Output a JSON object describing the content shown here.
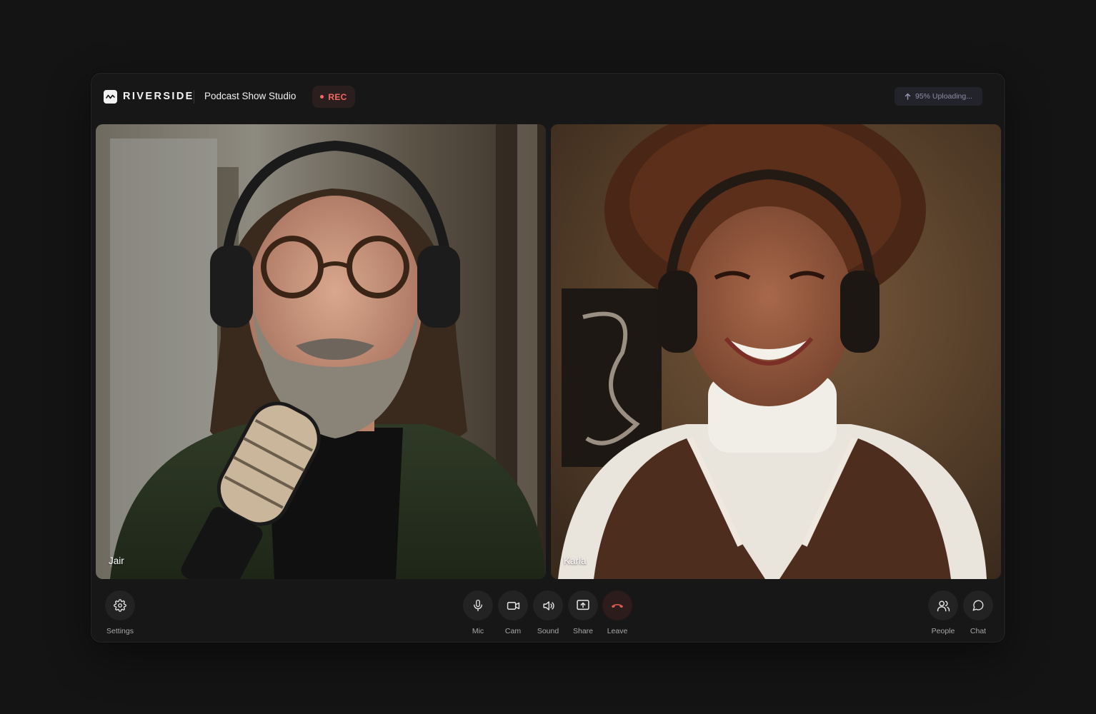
{
  "app": {
    "brand": "RIVERSIDE",
    "studio_title": "Podcast Show Studio",
    "rec_label": "REC",
    "upload_status": "95% Uploading...",
    "upload_progress": 0.95
  },
  "participants": [
    {
      "name": "Jair"
    },
    {
      "name": "Karla"
    }
  ],
  "controls": {
    "left": [
      {
        "label": "Settings",
        "icon": "gear-icon"
      }
    ],
    "center": [
      {
        "label": "Mic",
        "icon": "microphone-icon"
      },
      {
        "label": "Cam",
        "icon": "camera-icon"
      },
      {
        "label": "Sound",
        "icon": "speaker-icon"
      },
      {
        "label": "Share",
        "icon": "share-screen-icon"
      },
      {
        "label": "Leave",
        "icon": "hang-up-icon"
      }
    ],
    "right": [
      {
        "label": "People",
        "icon": "people-icon"
      },
      {
        "label": "Chat",
        "icon": "chat-bubble-icon"
      }
    ]
  },
  "colors": {
    "background": "#141414",
    "panel": "#171717",
    "rec": "#f06a63",
    "leave": "#e05a55",
    "upload_text": "#8e8ea6"
  }
}
